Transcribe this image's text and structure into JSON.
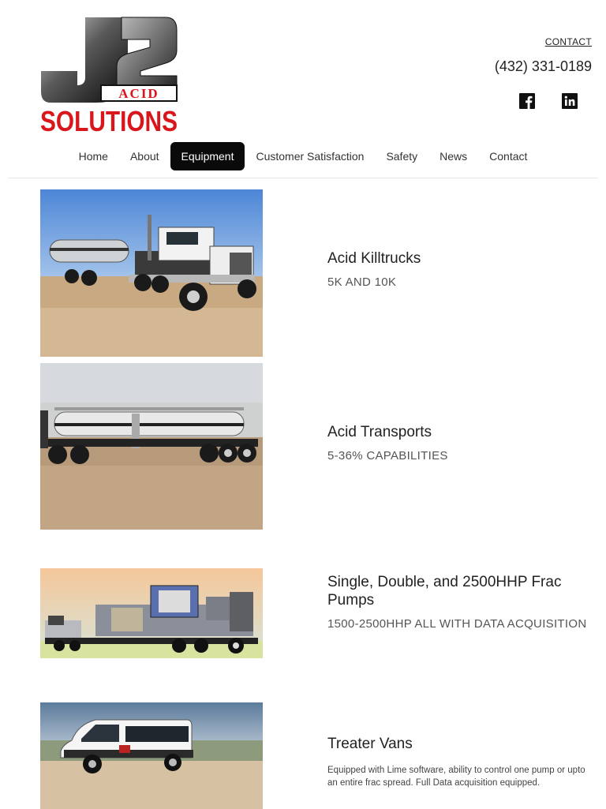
{
  "header": {
    "logo": {
      "text_top": "J2",
      "text_mid": "ACID",
      "text_bottom": "SOLUTIONS"
    },
    "contact_label": "CONTACT",
    "phone": "(432) 331-0189",
    "social": [
      {
        "icon": "facebook-icon"
      },
      {
        "icon": "linkedin-icon"
      }
    ]
  },
  "nav": {
    "items": [
      {
        "label": "Home",
        "active": false
      },
      {
        "label": "About",
        "active": false
      },
      {
        "label": "Equipment",
        "active": true
      },
      {
        "label": "Customer Satisfaction",
        "active": false
      },
      {
        "label": "Safety",
        "active": false
      },
      {
        "label": "News",
        "active": false
      },
      {
        "label": "Contact",
        "active": false
      }
    ],
    "active_color": "#0a0a0a"
  },
  "equipment": [
    {
      "title": "Acid Killtrucks",
      "subtitle": "5K AND 10K",
      "description": ""
    },
    {
      "title": "Acid Transports",
      "subtitle": "5-36% CAPABILITIES",
      "description": ""
    },
    {
      "title": "Single, Double, and 2500HHP Frac Pumps",
      "subtitle": "1500-2500HHP ALL WITH DATA ACQUISITION",
      "description": ""
    },
    {
      "title": "Treater Vans",
      "subtitle": "",
      "description": "Equipped with Lime software, ability to control one pump or upto an entire frac spread. Full Data acquisition equipped."
    }
  ],
  "colors": {
    "brand_red": "#d8161b",
    "brand_black": "#111111"
  }
}
